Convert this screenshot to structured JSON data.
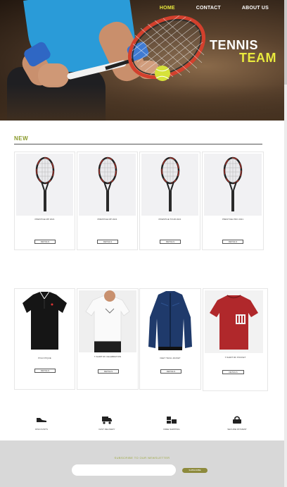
{
  "nav": {
    "items": [
      {
        "label": "HOME",
        "active": true
      },
      {
        "label": "CONTACT",
        "active": false
      },
      {
        "label": "ABOUT US",
        "active": false
      }
    ]
  },
  "brand": {
    "line1": "TENNIS",
    "line2": "TEAM",
    "line1_color": "#ffffff",
    "line2_color": "#e9ea3d"
  },
  "section": {
    "title": "NEW"
  },
  "products_row1": [
    {
      "name": "PRESTIGE MP 2021",
      "button": "DETAILS"
    },
    {
      "name": "PRESTIGE MP 2021",
      "button": "DETAILS"
    },
    {
      "name": "PRESTIGE TOUR 2021",
      "button": "DETAILS"
    },
    {
      "name": "PRESTIGE PRO 2021",
      "button": "DETAILS"
    }
  ],
  "products_row2": [
    {
      "name": "POLO PIQUE",
      "button": "DETAILS",
      "icon": "black-polo-shirt"
    },
    {
      "name": "T-SHIRT RF CELEBRATION",
      "button": "DETAILS",
      "icon": "white-t-shirt"
    },
    {
      "name": "FEET TECH JACKET",
      "button": "DETAILS",
      "icon": "navy-jacket"
    },
    {
      "name": "T-SHIRT RF POCKET",
      "button": "DETAILS",
      "icon": "red-t-shirt"
    }
  ],
  "features": [
    {
      "label": "DISCOUNTS",
      "icon": "shoe-icon"
    },
    {
      "label": "FAST DELIVERY",
      "icon": "truck-icon"
    },
    {
      "label": "FREE SHIPPING",
      "icon": "boxes-icon"
    },
    {
      "label": "SECURE PAYMENT",
      "icon": "lock-icon"
    }
  ],
  "newsletter": {
    "title": "SUBSCRIBE TO OUR NEWSLETTER",
    "placeholder": "",
    "button": "SUBSCRIBE"
  },
  "colors": {
    "accent": "#e9ea3d",
    "olive": "#8d8a3c",
    "title_green": "#8a9a2b",
    "footer_bg": "#d8d8d8"
  }
}
